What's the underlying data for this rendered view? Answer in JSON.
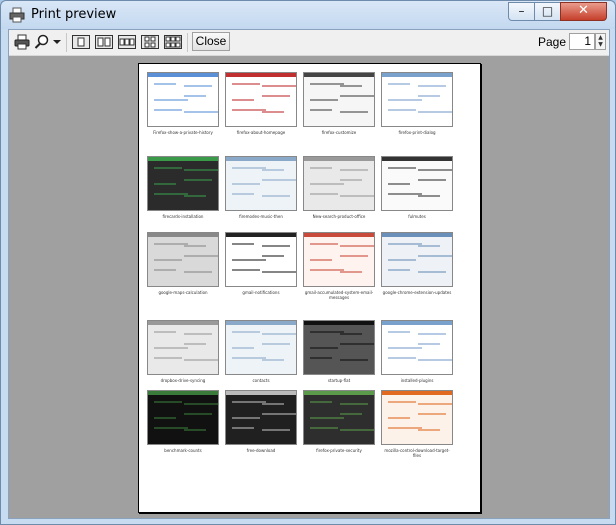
{
  "window": {
    "title": "Print preview",
    "min_glyph": "–",
    "max_glyph": "□",
    "close_glyph": "✕"
  },
  "toolbar": {
    "close_label": "Close",
    "page_label": "Page",
    "page_value": "1",
    "icons": [
      "print-icon",
      "zoom-icon",
      "dropdown-arrow-icon",
      "one-page-icon",
      "two-pages-icon",
      "three-pages-icon",
      "four-pages-icon",
      "six-pages-icon"
    ]
  },
  "thumbnails": [
    {
      "caption": "Firefox-show-a-private-history",
      "theme": "white-blue"
    },
    {
      "caption": "firefox-about-homepage",
      "theme": "white-red"
    },
    {
      "caption": "firefox-customize",
      "theme": "list"
    },
    {
      "caption": "firefox-print-dialog",
      "theme": "white"
    },
    {
      "caption": "firecards-installation",
      "theme": "dark-green"
    },
    {
      "caption": "firemodes-music-then",
      "theme": "light"
    },
    {
      "caption": "New-search-product-office",
      "theme": "light-gray"
    },
    {
      "caption": "fulmutes",
      "theme": "white-dark"
    },
    {
      "caption": "google-maps-calculation",
      "theme": "gray"
    },
    {
      "caption": "gmail-notifications",
      "theme": "white-dark-border"
    },
    {
      "caption": "gmail-accumulated-system-email-messages",
      "theme": "red-text"
    },
    {
      "caption": "google-chrome-extension-updates",
      "theme": "mixed"
    },
    {
      "caption": "dropbox-drive-syncing",
      "theme": "light-gray"
    },
    {
      "caption": "contacts",
      "theme": "light"
    },
    {
      "caption": "startup-flat",
      "theme": "dark-photo"
    },
    {
      "caption": "installed-plugins",
      "theme": "white"
    },
    {
      "caption": "benchmark-counts",
      "theme": "black"
    },
    {
      "caption": "free-download",
      "theme": "dark-doc"
    },
    {
      "caption": "firefox-private-security",
      "theme": "dark-green-photo"
    },
    {
      "caption": "mozilla-control-download-target-files",
      "theme": "orange"
    }
  ]
}
